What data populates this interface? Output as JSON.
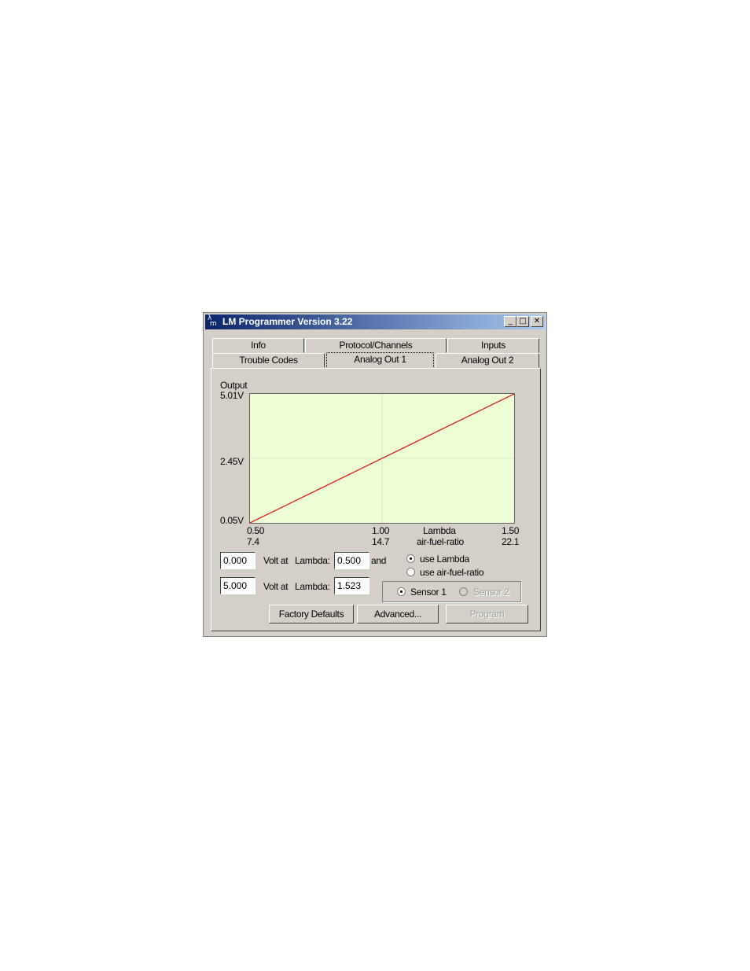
{
  "window": {
    "title": "LM Programmer Version 3.22"
  },
  "titlebar_buttons": {
    "minimize": "_",
    "maximize": "□",
    "close": "✕"
  },
  "tabs_row1": [
    {
      "label": "Info"
    },
    {
      "label": "Protocol/Channels"
    },
    {
      "label": "Inputs"
    }
  ],
  "tabs_row2": [
    {
      "label": "Trouble Codes"
    },
    {
      "label": "Analog Out 1",
      "active": true
    },
    {
      "label": "Analog Out 2"
    }
  ],
  "chart": {
    "output_label": "Output",
    "y_ticks": [
      "5.01V",
      "2.45V",
      "0.05V"
    ],
    "x_ticks_lambda": [
      "0.50",
      "1.00",
      "1.50"
    ],
    "x_ticks_afr": [
      "7.4",
      "14.7",
      "22.1"
    ],
    "x_label_lambda": "Lambda",
    "x_label_afr": "air-fuel-ratio"
  },
  "chart_data": {
    "type": "line",
    "series": [
      {
        "x": [
          0.5,
          1.5
        ],
        "y": [
          0.05,
          5.01
        ],
        "color": "#e02020"
      }
    ],
    "xlim": [
      0.5,
      1.5
    ],
    "ylim": [
      0.05,
      5.01
    ],
    "grid": true
  },
  "form": {
    "row1": {
      "volt_value": "0.000",
      "volt_at": "Volt at",
      "lambda_label": "Lambda:",
      "lambda_value": "0.500",
      "and": "and"
    },
    "row2": {
      "volt_value": "5.000",
      "volt_at": "Volt at",
      "lambda_label": "Lambda:",
      "lambda_value": "1.523"
    },
    "mode": {
      "use_lambda": "use Lambda",
      "use_afr": "use air-fuel-ratio",
      "selected": "use Lambda"
    },
    "sensor": {
      "sensor1": "Sensor 1",
      "sensor2": "Sensor 2",
      "selected": "Sensor 1"
    }
  },
  "buttons": {
    "factory_defaults": "Factory Defaults",
    "advanced": "Advanced...",
    "program": "Program"
  },
  "colors": {
    "plot_bg": "#eeffd6",
    "line": "#e02020",
    "titlebar_start": "#0a246a",
    "titlebar_end": "#a6caf0"
  }
}
